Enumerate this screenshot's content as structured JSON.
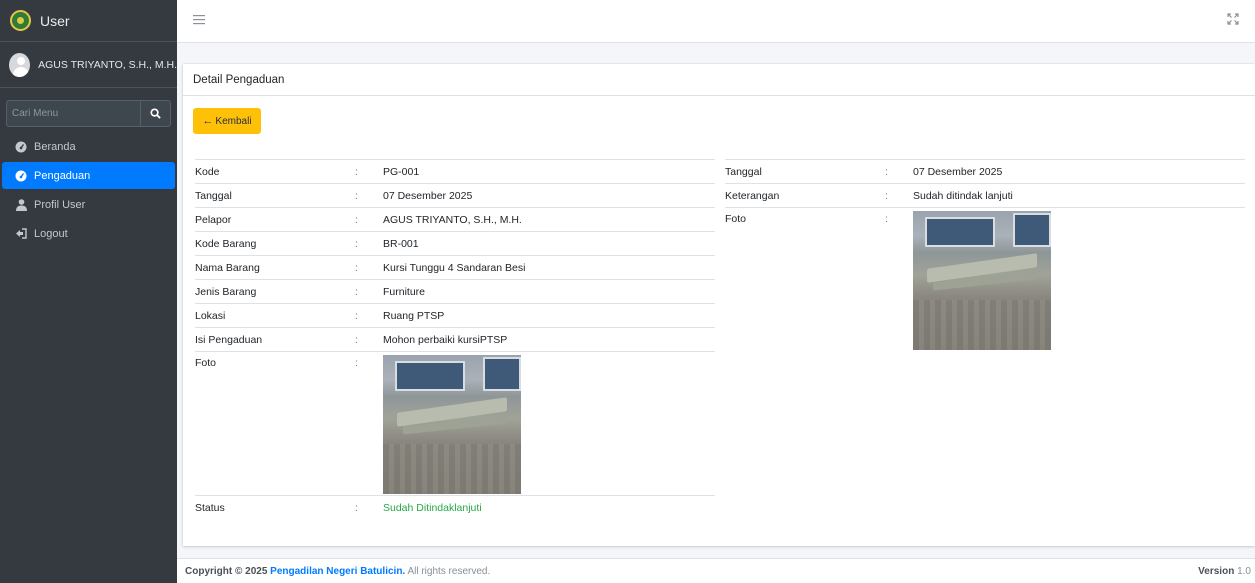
{
  "brand": {
    "title": "User"
  },
  "user": {
    "name": "AGUS TRIYANTO, S.H., M.H."
  },
  "search": {
    "placeholder": "Cari Menu"
  },
  "nav": {
    "items": [
      {
        "label": "Beranda",
        "icon": "tachometer-icon"
      },
      {
        "label": "Pengaduan",
        "icon": "tachometer-icon",
        "active": true
      },
      {
        "label": "Profil User",
        "icon": "user-icon"
      },
      {
        "label": "Logout",
        "icon": "sign-out-icon"
      }
    ]
  },
  "card": {
    "title": "Detail Pengaduan",
    "back_label": "Kembali"
  },
  "detail": {
    "separator": ":",
    "left": [
      {
        "label": "Kode",
        "value": "PG-001"
      },
      {
        "label": "Tanggal",
        "value": "07 Desember 2025"
      },
      {
        "label": "Pelapor",
        "value": "AGUS TRIYANTO, S.H., M.H."
      },
      {
        "label": "Kode Barang",
        "value": "BR-001"
      },
      {
        "label": "Nama Barang",
        "value": "Kursi Tunggu 4 Sandaran Besi"
      },
      {
        "label": "Jenis Barang",
        "value": "Furniture"
      },
      {
        "label": "Lokasi",
        "value": "Ruang PTSP"
      },
      {
        "label": "Isi Pengaduan",
        "value": "Mohon perbaiki kursiPTSP"
      },
      {
        "label": "Foto",
        "value": ""
      },
      {
        "label": "Status",
        "value": "Sudah Ditindaklanjuti"
      }
    ],
    "right": [
      {
        "label": "Tanggal",
        "value": "07 Desember 2025"
      },
      {
        "label": "Keterangan",
        "value": "Sudah ditindak lanjuti"
      },
      {
        "label": "Foto",
        "value": ""
      }
    ]
  },
  "colors": {
    "accent": "#007bff",
    "back_button": "#ffc107",
    "status": "#28a745",
    "sidebar": "#343a40"
  },
  "footer": {
    "copyright": "Copyright © 2025",
    "org": "Pengadilan Negeri Batulicin.",
    "rights": "All rights reserved.",
    "version_label": "Version",
    "version": "1.0"
  }
}
